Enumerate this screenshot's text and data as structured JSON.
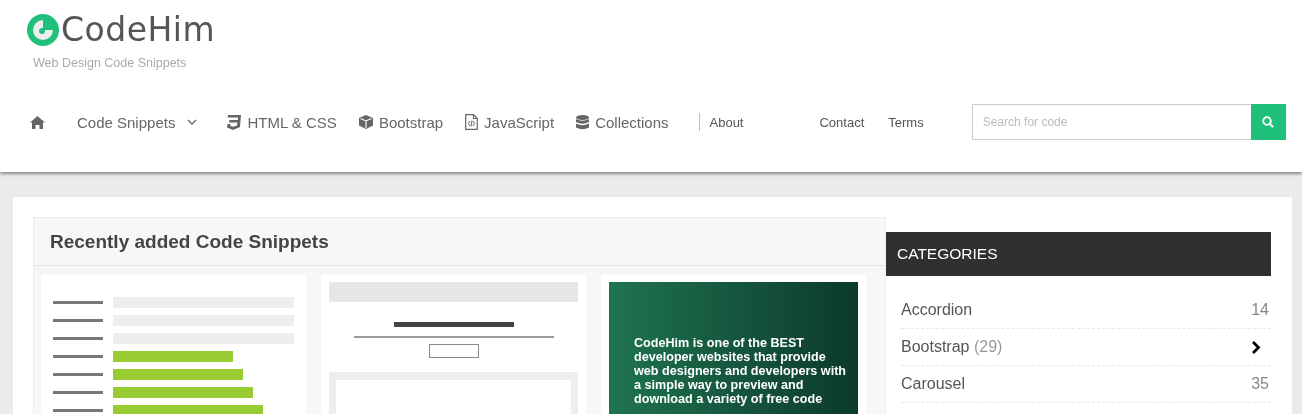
{
  "header": {
    "logo": "CodeHim",
    "tagline": "Web Design Code Snippets",
    "nav": [
      {
        "kind": "home"
      },
      {
        "kind": "dropdown",
        "label": "Code Snippets"
      },
      {
        "kind": "css",
        "label": "HTML & CSS"
      },
      {
        "kind": "cube",
        "label": "Bootstrap"
      },
      {
        "kind": "file",
        "label": "JavaScript"
      },
      {
        "kind": "stack",
        "label": "Collections"
      }
    ],
    "links": [
      "About",
      "Contact",
      "Terms"
    ],
    "search": {
      "placeholder": "Search for code"
    }
  },
  "recent": {
    "title": "Recently added Code Snippets",
    "cards": [
      {
        "kind": "breadcrumbs"
      },
      {
        "kind": "navbar"
      },
      {
        "kind": "promo",
        "text": "CodeHim is one of the BEST developer websites that provide web designers and developers with a simple way to preview and download a variety of free code"
      }
    ]
  },
  "categories": {
    "title": "CATEGORIES",
    "items": [
      {
        "name": "Accordion",
        "count": "14",
        "hovered": false
      },
      {
        "name": "Bootstrap",
        "count": "(29)",
        "hovered": true
      },
      {
        "name": "Carousel",
        "count": "35",
        "hovered": false
      }
    ]
  }
}
